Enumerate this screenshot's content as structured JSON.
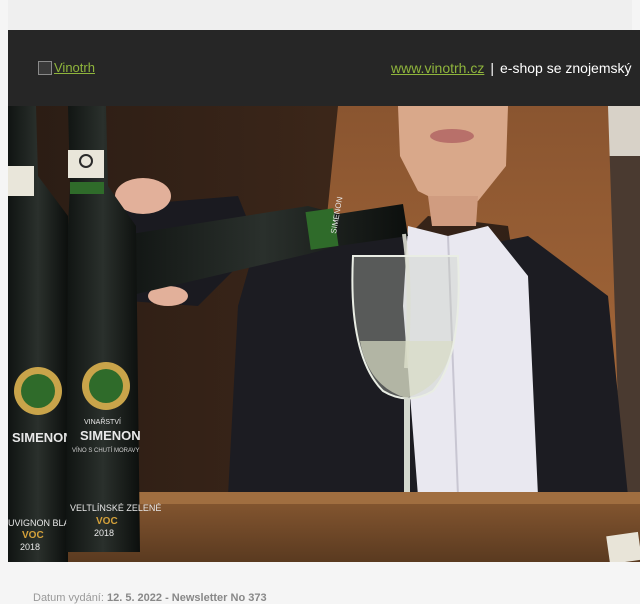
{
  "header": {
    "logo_alt": "Vinotrh",
    "link_text": "www.vinotrh.cz",
    "separator": "|",
    "tagline": "e-shop se znojemský"
  },
  "hero": {
    "bottle_brand": "SIMENON",
    "bottle_winery": "VINAŘSTVÍ",
    "bottle_region": "VÍNO S CHUTÍ MORAVY",
    "bottle1_variety": "UVIGNON BLANC",
    "bottle2_variety": "VELTLÍNSKÉ ZELENÉ",
    "bottle_grade": "VOC",
    "bottle_year": "2018",
    "pour_bottle_label": "SIMENON"
  },
  "footer": {
    "date_label": "Datum vydání:",
    "date_value": "12. 5. 2022 - Newsletter No 373"
  },
  "colors": {
    "header_bg": "#262626",
    "link": "#8fb53c",
    "label_gold": "#c9a44a",
    "label_green": "#2f6b2a"
  }
}
